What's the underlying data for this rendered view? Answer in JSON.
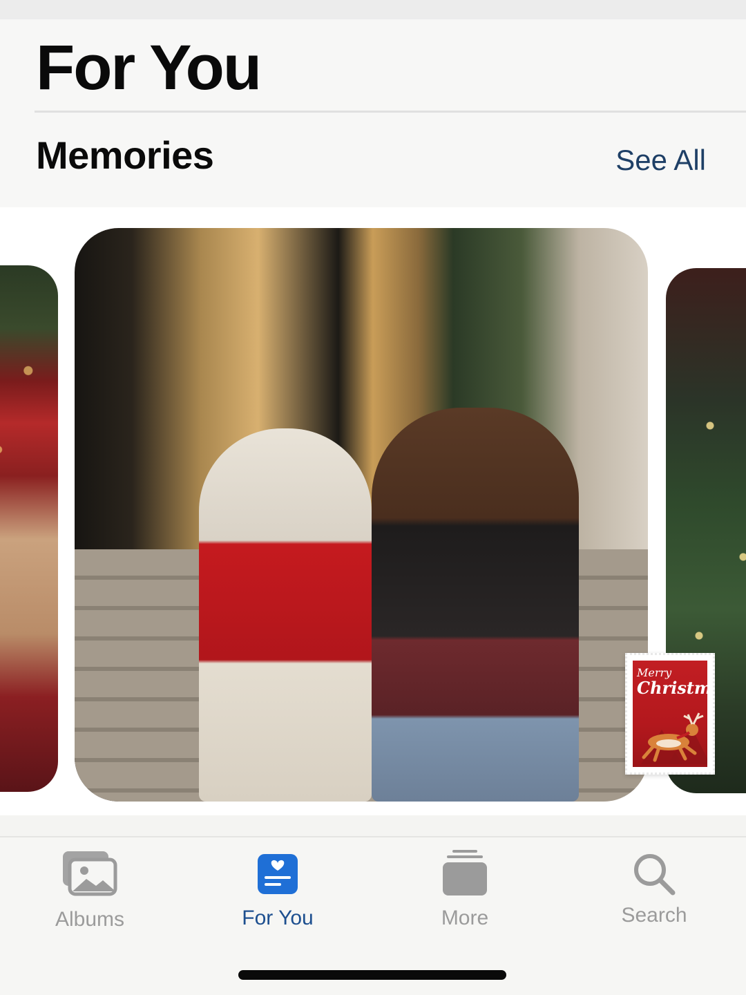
{
  "header": {
    "title": "For You",
    "section_title": "Memories",
    "see_all_label": "See All"
  },
  "memory_card": {
    "sticker_line1": "Merry",
    "sticker_line2": "Christmas"
  },
  "tabbar": {
    "tabs": [
      {
        "label": "Albums",
        "icon": "albums-icon",
        "active": false
      },
      {
        "label": "For You",
        "icon": "for-you-icon",
        "active": true
      },
      {
        "label": "More",
        "icon": "more-stack-icon",
        "active": false
      },
      {
        "label": "Search",
        "icon": "search-icon",
        "active": false
      }
    ]
  },
  "colors": {
    "accent": "#1d4f8f",
    "inactive": "#9b9b9b"
  }
}
